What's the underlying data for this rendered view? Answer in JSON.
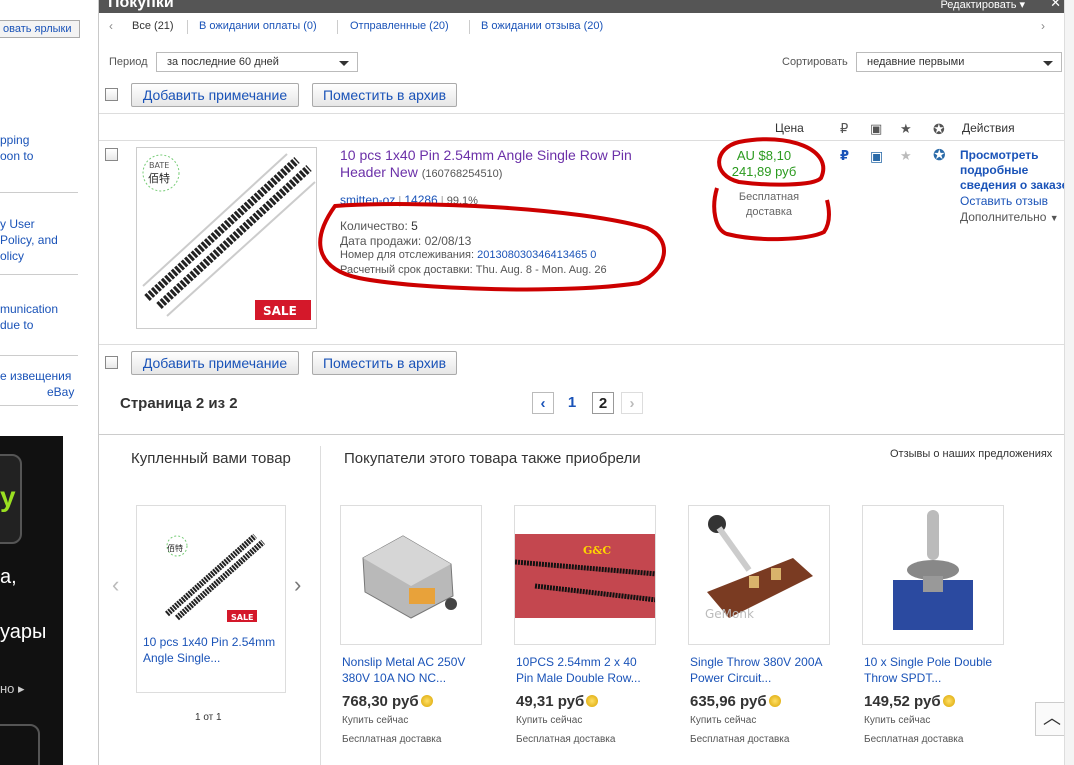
{
  "sidebar": {
    "label_button": "овать ярлыки",
    "links": [
      "pping",
      "oon to",
      "y User",
      "Policy, and",
      "olicy",
      "munication",
      "due to",
      "е извещения",
      "eBay"
    ]
  },
  "ad": {
    "lines": [
      "y",
      "а,",
      "уары",
      "но ▸"
    ]
  },
  "header": {
    "title": "Покупки",
    "edit": "Редактировать ▾",
    "close": "✕"
  },
  "tabs": [
    {
      "label": "Все",
      "count": "(21)"
    },
    {
      "label": "В ожидании оплаты",
      "count": "(0)"
    },
    {
      "label": "Отправленные",
      "count": "(20)"
    },
    {
      "label": "В ожидании отзыва",
      "count": "(20)"
    }
  ],
  "filters": {
    "period_label": "Период",
    "period_value": "за последние 60 дней",
    "sort_label": "Сортировать",
    "sort_value": "недавние первыми"
  },
  "bulk": {
    "add_note": "Добавить примечание",
    "archive": "Поместить в архив"
  },
  "columns": {
    "price": "Цена",
    "actions": "Действия"
  },
  "item": {
    "title": "10 pcs 1x40 Pin 2.54mm Angle Single Row Pin Header New",
    "item_id": "(160768254510)",
    "seller": "smitten-oz",
    "feedback": "14286",
    "positive": "99.1%",
    "qty_label": "Количество:",
    "qty": "5",
    "sale_date_label": "Дата продажи:",
    "sale_date": "02/08/13",
    "tracking_label": "Номер для отслеживания:",
    "tracking": "201308030346413465 0",
    "delivery": "Расчетный срок доставки: Thu. Aug. 8 - Mon. Aug. 26",
    "price_au": "AU $8,10",
    "price_rub": "241,89 руб",
    "shipping_line1": "Бесплатная",
    "shipping_line2": "доставка",
    "action_view": "Просмотреть подробные сведения о заказе",
    "action_feedback": "Оставить отзыв",
    "action_more": "Дополнительно"
  },
  "pagination": {
    "label": "Страница 2 из 2",
    "pages": [
      "1",
      "2"
    ]
  },
  "bought": {
    "heading": "Купленный вами товар",
    "title": "10 pcs 1x40 Pin 2.54mm Angle Single...",
    "counter": "1 от 1"
  },
  "also": {
    "heading": "Покупатели этого товара также приобрели",
    "feedback_link": "Отзывы о наших предложениях",
    "items": [
      {
        "title": "Nonslip Metal AC 250V 380V 10A NO NC...",
        "price": "768,30 руб",
        "buy": "Купить сейчас",
        "ship": "Бесплатная доставка"
      },
      {
        "title": "10PCS 2.54mm 2 x 40 Pin Male Double Row...",
        "price": "49,31 руб",
        "buy": "Купить сейчас",
        "ship": "Бесплатная доставка"
      },
      {
        "title": "Single Throw 380V 200A Power Circuit...",
        "price": "635,96 руб",
        "buy": "Купить сейчас",
        "ship": "Бесплатная доставка"
      },
      {
        "title": "10 x Single Pole Double Throw SPDT...",
        "price": "149,52 руб",
        "buy": "Купить сейчас",
        "ship": "Бесплатная доставка"
      }
    ]
  },
  "colors": {
    "link": "#1a53b8",
    "price_green": "#2a9a1e",
    "annotation_red": "#cc0000",
    "title_purple": "#6b30a8"
  }
}
